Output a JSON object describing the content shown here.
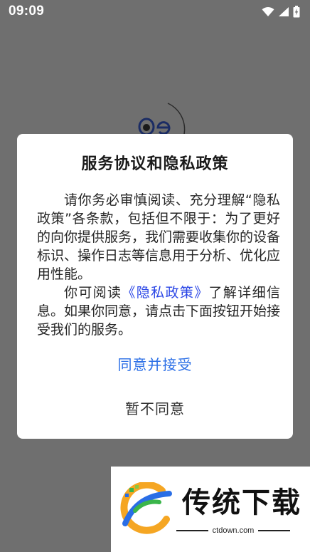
{
  "status_bar": {
    "time": "09:09",
    "icons": [
      "wifi-icon",
      "signal-icon",
      "battery-charging-icon"
    ]
  },
  "dialog": {
    "title": "服务协议和隐私政策",
    "paragraph1": "请你务必审慎阅读、充分理解“隐私政策”各条款，包括但不限于：为了更好的向你提供服务，我们需要收集你的设备标识、操作日志等信息用于分析、优化应用性能。",
    "paragraph2_before": "你可阅读",
    "policy_link": "《隐私政策》",
    "paragraph2_after": "了解详细信息。如果你同意，请点击下面按钮开始接受我们的服务。",
    "accept_label": "同意并接受",
    "decline_label": "暂不同意"
  },
  "watermark": {
    "title": "传统下载",
    "url": "ctdown.com"
  },
  "colors": {
    "overlay": "#6f6f6f",
    "link": "#2a46e6",
    "accept": "#2a6ee6"
  }
}
